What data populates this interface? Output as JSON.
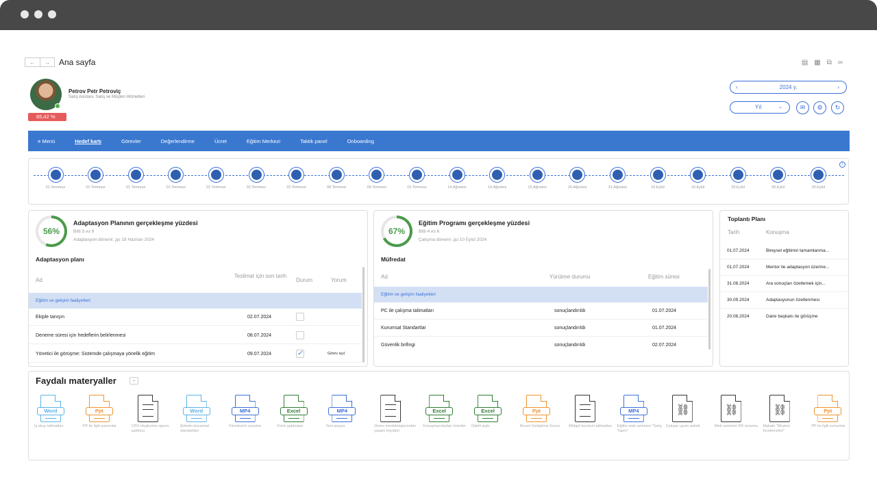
{
  "page": {
    "title": "Ana sayfa",
    "nav_back": "←",
    "nav_forward": "→"
  },
  "top_icons": [
    "save-icon",
    "print-icon",
    "export-icon",
    "link-icon"
  ],
  "user": {
    "name": "Petrov Petr Petroviç",
    "role": "Satış Asistanı, Satış ve Müşteri Hizmetleri",
    "badge": "65,42 %"
  },
  "period": {
    "year": "2024 y.",
    "prev": "‹",
    "next": "›",
    "granularity": "Yıl",
    "chevron": "⌄"
  },
  "action_icons": [
    "chat-icon",
    "settings-icon",
    "refresh-icon"
  ],
  "nav": {
    "menu": "≡ Menü",
    "items": [
      "Hedef kartı",
      "Görevler",
      "Değerlendirme",
      "Ücret",
      "Eğitim Merkezi",
      "Taktik panel",
      "Onboarding"
    ],
    "active": "Hedef kartı"
  },
  "timeline": [
    {
      "date": "01.Temmuz",
      "icon": "graduation-cap-icon"
    },
    {
      "date": "01.Temmuz",
      "icon": "graduation-cap-icon"
    },
    {
      "date": "01.Temmuz",
      "icon": "chat-bubble-icon"
    },
    {
      "date": "01.Temmuz",
      "icon": "chat-bubble-icon"
    },
    {
      "date": "02.Temmuz",
      "icon": "graduation-cap-icon"
    },
    {
      "date": "02.Temmuz",
      "icon": "graduation-cap-icon"
    },
    {
      "date": "02.Temmuz",
      "icon": "chart-icon"
    },
    {
      "date": "08.Temmuz",
      "icon": "chart-icon"
    },
    {
      "date": "09.Temmuz",
      "icon": "chart-icon"
    },
    {
      "date": "15.Temmuz",
      "icon": "chart-icon"
    },
    {
      "date": "14.Ağustos",
      "icon": "graduation-cap-icon"
    },
    {
      "date": "14.Ağustos",
      "icon": "chart-icon"
    },
    {
      "date": "15.Ağustos",
      "icon": "chart-icon"
    },
    {
      "date": "20.Ağustos",
      "icon": "chat-bubble-icon"
    },
    {
      "date": "31.Ağustos",
      "icon": "chat-bubble-icon"
    },
    {
      "date": "10.Eylül",
      "icon": "graduation-cap-icon"
    },
    {
      "date": "10.Eylül",
      "icon": "chart-icon"
    },
    {
      "date": "30.Eylül",
      "icon": "chart-icon"
    },
    {
      "date": "30.Eylül",
      "icon": "chart-icon"
    },
    {
      "date": "30.Eylül",
      "icon": "chat-bubble-icon"
    }
  ],
  "adaptation": {
    "percent": "56%",
    "percent_value": 56,
    "title": "Adaptasyon Planının gerçekleşme yüzdesi",
    "sub1": "Bitti 5 из 9",
    "sub2": "Adaptasyon dönemi: до 18 Haziran 2024",
    "section": "Adaptasyon planı",
    "headers": {
      "name": "Ad",
      "due": "Teslimat için son tarih",
      "status": "Durum",
      "comment": "Yorum"
    },
    "group": "Eğitim ve gelişim faaliyetleri",
    "rows": [
      {
        "name": "Ekiple tanışın",
        "date": "02.07.2024",
        "done": false,
        "comment": ""
      },
      {
        "name": "Deneme süresi için hedeflerin belirlenmesi",
        "date": "08.07.2024",
        "done": false,
        "comment": ""
      },
      {
        "name": "Yönetici ile görüşme: Sistemde çalışmaya yönelik eğitim",
        "date": "09.07.2024",
        "done": true,
        "comment": "Görev açıl"
      }
    ]
  },
  "education": {
    "percent": "67%",
    "percent_value": 67,
    "title": "Eğitim Programı gerçekleşme yüzdesi",
    "sub1": "Bitti 4 из 6",
    "sub2": "Çalışma dönemi: до 10 Eylül 2024",
    "section": "Müfredat",
    "headers": {
      "name": "Ad",
      "status": "Yürütme durumu",
      "duration": "Eğitim süresi"
    },
    "group": "Eğitim ve gelişim faaliyetleri",
    "rows": [
      {
        "name": "PC ile çalışma talimatları",
        "status": "sonuçlandırıldı",
        "date": "01.07.2024"
      },
      {
        "name": "Kurumsal Standartlar",
        "status": "sonuçlandırıldı",
        "date": "01.07.2024"
      },
      {
        "name": "Güvenlik brifingi",
        "status": "sonuçlandırıldı",
        "date": "02.07.2024"
      }
    ]
  },
  "meetings": {
    "title": "Toplantı Planı",
    "headers": {
      "date": "Tarih",
      "topic": "Konuşma"
    },
    "rows": [
      {
        "date": "01.07.2024",
        "topic": "Bireysel eğitimin tamamlanma..."
      },
      {
        "date": "01.07.2024",
        "topic": "Mentor ile adaptasyon üzerine..."
      },
      {
        "date": "31.08.2024",
        "topic": "Ara sonuçları özetlemek için..."
      },
      {
        "date": "30.09.2024",
        "topic": "Adaptasyonun özetlenmesi"
      },
      {
        "date": "20.08.2024",
        "topic": "Daire başkanı ile görüşme"
      }
    ]
  },
  "materials": {
    "title": "Faydalı materyaller",
    "chevron": "⌄",
    "items": [
      {
        "type": "word",
        "tag": "Word",
        "label": "İş akışı talimatları"
      },
      {
        "type": "ppt",
        "tag": "Ppt",
        "label": "PP ile ilgili sunumlar"
      },
      {
        "type": "doc",
        "tag": "",
        "label": "CPU oluşturma raporu şablonu"
      },
      {
        "type": "word",
        "tag": "Word",
        "label": "Şirketin kurumsal standartları"
      },
      {
        "type": "mp4",
        "tag": "MP4",
        "label": "Yöneticinin sunumu"
      },
      {
        "type": "excel",
        "tag": "Excel",
        "label": "Form şablonları"
      },
      {
        "type": "mp4",
        "tag": "MP4",
        "label": "Yeni arayüz"
      },
      {
        "type": "doc",
        "tag": "",
        "label": "Demo meslektaşlarından yaşam köyüleri"
      },
      {
        "type": "excel",
        "tag": "Excel",
        "label": "Konuşmacılardan öneriler"
      },
      {
        "type": "excel",
        "tag": "Excel",
        "label": "Dahili arşiv"
      },
      {
        "type": "ppt",
        "tag": "Ppt",
        "label": "Beceri Geliştirme Kursu"
      },
      {
        "type": "doc",
        "tag": "",
        "label": "Widget kurulum talimatları"
      },
      {
        "type": "mp4",
        "tag": "MP4",
        "label": "Eğitim web semineri \"Satış Yapın\""
      },
      {
        "type": "link",
        "tag": "",
        "label": "Çalışan uyum anketi"
      },
      {
        "type": "link",
        "tag": "",
        "label": "Web semineri KR sunumu"
      },
      {
        "type": "link",
        "tag": "",
        "label": "Makale \"Müşteri İncelemeleri\""
      },
      {
        "type": "ppt",
        "tag": "Ppt",
        "label": "PP ile ilgili sunumlar"
      }
    ]
  },
  "colors": {
    "accent": "#3a78d0",
    "badge": "#e55b5b",
    "progress": "#4a9a4a",
    "group_row": "#d3e0f4"
  }
}
